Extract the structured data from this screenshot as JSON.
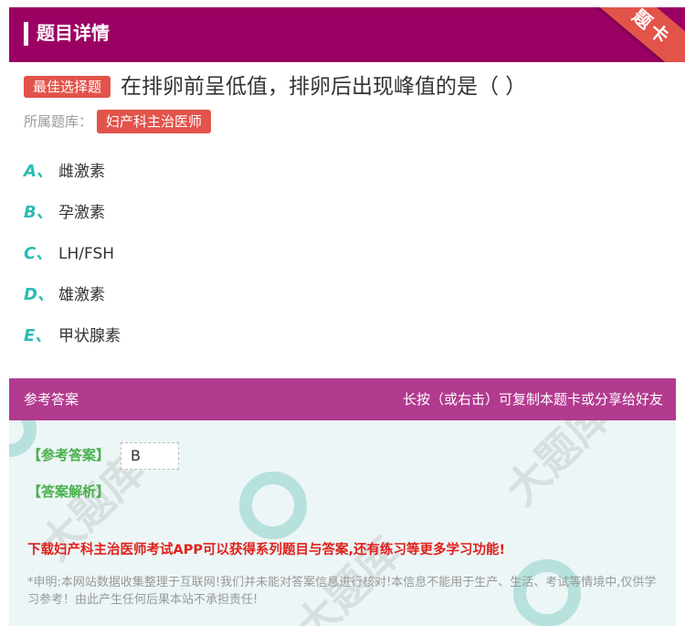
{
  "header": {
    "title": "题目详情",
    "ribbon": "题卡"
  },
  "question": {
    "type_badge": "最佳选择题",
    "text": "在排卵前呈低值，排卵后出现峰值的是（ ）",
    "bank_label": "所属题库：",
    "bank_name": "妇产科主治医师"
  },
  "options": [
    {
      "letter": "A、",
      "text": "雌激素"
    },
    {
      "letter": "B、",
      "text": "孕激素"
    },
    {
      "letter": "C、",
      "text": "LH/FSH"
    },
    {
      "letter": "D、",
      "text": "雄激素"
    },
    {
      "letter": "E、",
      "text": "甲状腺素"
    }
  ],
  "answer_section": {
    "title": "参考答案",
    "hint": "长按（或右击）可复制本题卡或分享给好友",
    "ref_label": "【参考答案】",
    "ref_value": "B",
    "analysis_label": "【答案解析】",
    "promo": "下载妇产科主治医师考试APP可以获得系列题目与答案,还有练习等更多学习功能!",
    "disclaimer": "*申明:本网站数据收集整理于互联网!我们并未能对答案信息进行核对!本信息不能用于生产、生活、考试等情境中,仅供学习参考！由此产生任何后果本站不承担责任!"
  },
  "colors": {
    "header_bg": "#9b0163",
    "accent_red": "#e2534a",
    "option_letter": "#2bbcb4",
    "answer_header_bg": "#b23a8f",
    "answer_body_bg": "#ecf6f6",
    "label_green": "#47b04b",
    "promo_red": "#e0201c"
  }
}
